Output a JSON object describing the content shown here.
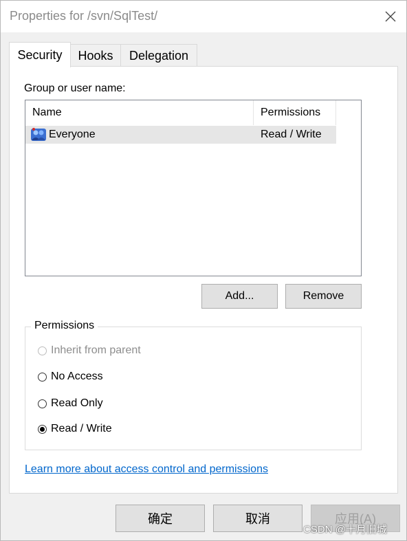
{
  "window": {
    "title": "Properties for /svn/SqlTest/",
    "close_icon": "close-icon"
  },
  "tabs": [
    {
      "label": "Security",
      "active": true
    },
    {
      "label": "Hooks",
      "active": false
    },
    {
      "label": "Delegation",
      "active": false
    }
  ],
  "security": {
    "group_label": "Group or user name:",
    "columns": {
      "name": "Name",
      "permissions": "Permissions"
    },
    "rows": [
      {
        "icon": "user-group-icon",
        "name": "Everyone",
        "permissions": "Read / Write",
        "selected": true
      }
    ],
    "add_button": "Add...",
    "remove_button": "Remove",
    "permissions_group": {
      "title": "Permissions",
      "options": [
        {
          "label": "Inherit from parent",
          "checked": false,
          "disabled": true
        },
        {
          "label": "No Access",
          "checked": false,
          "disabled": false
        },
        {
          "label": "Read Only",
          "checked": false,
          "disabled": false
        },
        {
          "label": "Read / Write",
          "checked": true,
          "disabled": false
        }
      ]
    },
    "learn_more_link": "Learn more about access control and permissions"
  },
  "footer": {
    "ok_label": "确定",
    "cancel_label": "取消",
    "apply_label": "应用(A)",
    "apply_disabled": true
  },
  "watermark": "CSDN @十月旧城",
  "colors": {
    "link": "#0066cc",
    "selected_row": "#e6e6e6",
    "button_face": "#e1e1e1"
  }
}
